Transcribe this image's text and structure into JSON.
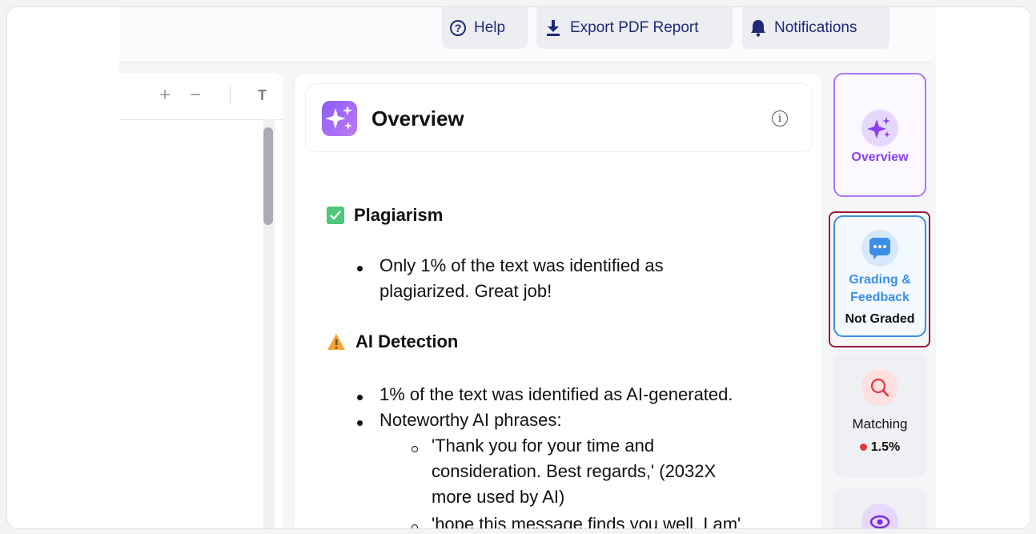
{
  "topbar": {
    "help_label": "Help",
    "export_label": "Export PDF Report",
    "notifications_label": "Notifications"
  },
  "doc_toolbar": {
    "zoom_in": "+",
    "zoom_out": "−",
    "text_tool": "T"
  },
  "overview": {
    "title": "Overview",
    "info_glyph": "i",
    "sections": {
      "plagiarism": {
        "heading": "Plagiarism",
        "status_icon": "check-square-icon",
        "bullet_line1": "Only 1% of the text was identified as",
        "bullet_line2": "plagiarized. Great job!"
      },
      "ai_detection": {
        "heading": "AI Detection",
        "status_icon": "warning-icon",
        "bullet1": "1% of the text was identified as AI-generated.",
        "bullet2": "Noteworthy AI phrases:",
        "phrase1_line1": "'Thank you for your time and",
        "phrase1_line2": "consideration. Best regards,' (2032X",
        "phrase1_line3": "more used by AI)",
        "phrase2_line1": "'hope this message finds you well. I am'"
      }
    }
  },
  "rail": {
    "overview_label": "Overview",
    "grading_label_line1": "Grading &",
    "grading_label_line2": "Feedback",
    "grading_status": "Not Graded",
    "matching_label": "Matching",
    "matching_value": "1.5%"
  },
  "colors": {
    "accent_purple": "#8a3ff0",
    "accent_blue": "#3a8ee6",
    "highlight_border": "#9c1b37",
    "matching_dot": "#e8343a",
    "nav_text": "#1e2a78"
  }
}
